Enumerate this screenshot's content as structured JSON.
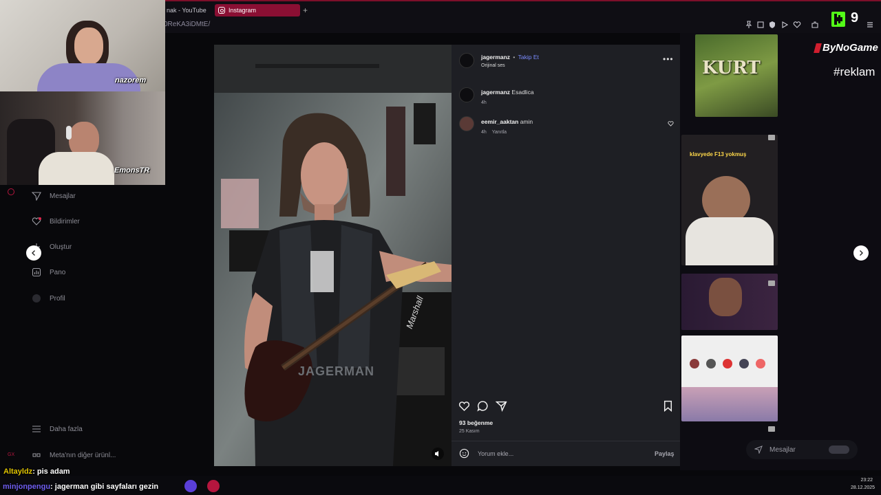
{
  "browser": {
    "tab_youtube": "nak - YouTube",
    "tab_instagram": "Instagram",
    "new_tab": "+",
    "url": "0ReKA3iDMtE/"
  },
  "webcams": {
    "cam1_name": "nazorem",
    "cam2_name": "EmonsTR"
  },
  "overlay": {
    "counter": "9",
    "brand": "ByNoGame",
    "hashtag": "#reklam",
    "clock_time": "23:22",
    "clock_date": "28.12.2025"
  },
  "nav": {
    "items": [
      {
        "label": "Mesajlar",
        "icon": "send-icon"
      },
      {
        "label": "Bildirimler",
        "icon": "heart-icon"
      },
      {
        "label": "Oluştur",
        "icon": "plus-icon"
      },
      {
        "label": "Pano",
        "icon": "chart-icon"
      },
      {
        "label": "Profil",
        "icon": "profile-icon"
      }
    ],
    "more": "Daha fazla",
    "meta": "Meta'nın diğer ürünl..."
  },
  "post": {
    "username": "jagermanz",
    "separator": "•",
    "follow": "Takip Et",
    "audio": "Orijinal ses",
    "caption_user": "jagermanz",
    "caption_text": "Esadlica",
    "caption_time": "4h",
    "comment_user": "eemir_aaktan",
    "comment_text": "amin",
    "comment_time": "4h",
    "reply": "Yanıtla",
    "likes": "93 beğenme",
    "date": "25 Kasım",
    "comment_placeholder": "Yorum ekle...",
    "share": "Paylaş",
    "shirt_text": "JAGERMAN",
    "amp_text": "Marshall"
  },
  "background": {
    "tile_kurt": "KURT",
    "tile_klavye": "klavyede F13 yokmuş",
    "mini_messages": "Mesajlar"
  },
  "chat": [
    {
      "user": "Altayldz",
      "text": ": pis adam"
    },
    {
      "user": "minjonpengu",
      "text": ": jagerman gibi sayfaları gezin"
    }
  ],
  "colors": {
    "accent_tab": "#8a0f33",
    "follow_link": "#7b8cff",
    "kick_green": "#53fc18"
  }
}
